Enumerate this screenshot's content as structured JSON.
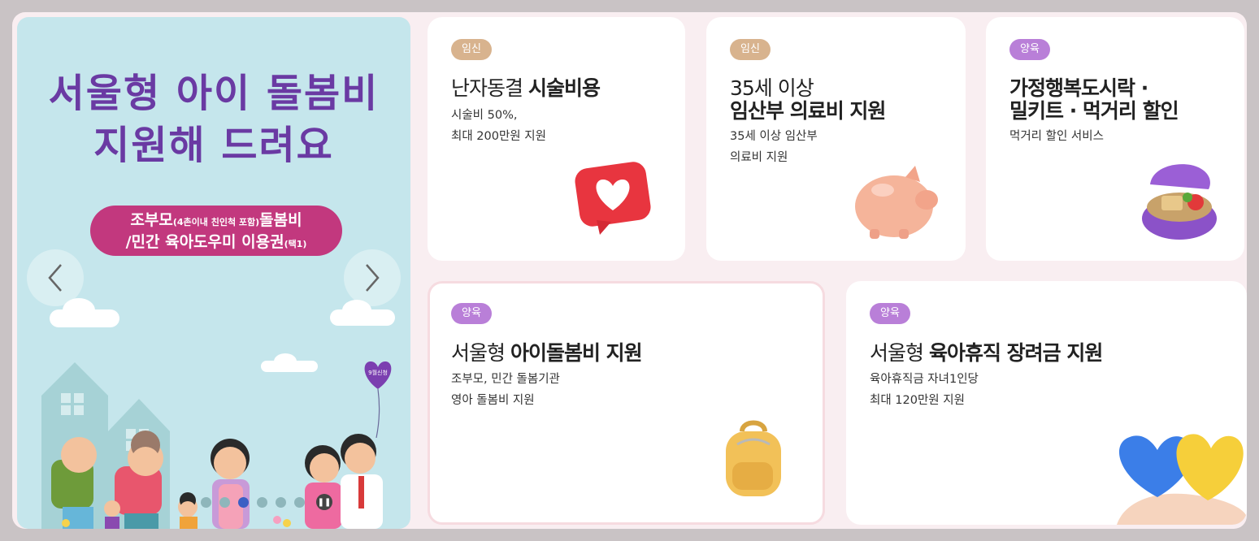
{
  "banner": {
    "title_line1": "서울형 아이 돌봄비",
    "title_line2": "지원해 드려요",
    "pill_part1": "조부모",
    "pill_small1": "(4촌이내 친인척 포함)",
    "pill_part2": "돌봄비",
    "pill_part3": "/민간 육아도우미 이용권",
    "pill_small2": "(택1)",
    "balloon_text": "9월신청",
    "active_slide": 3,
    "slide_count": 6
  },
  "cards": [
    {
      "tag": "임신",
      "title_light": "난자동결 ",
      "title_bold": "시술비용",
      "desc1": "시술비 50%,",
      "desc2": "최대 200만원 지원",
      "icon": "heart-notification-icon"
    },
    {
      "tag": "임신",
      "title_light": "35세 이상",
      "title_bold": "임산부 의료비 지원",
      "desc1": "35세 이상 임산부",
      "desc2": "의료비 지원",
      "icon": "piggy-bank-icon"
    },
    {
      "tag": "양육",
      "title_line1": "가정행복도시락 ·",
      "title_line2": "밀키트 · 먹거리 할인",
      "desc1": "먹거리 할인 서비스",
      "icon": "lunchbox-icon"
    },
    {
      "tag": "양육",
      "title_light": "서울형 ",
      "title_bold": "아이돌봄비 지원",
      "desc1": "조부모, 민간 돌봄기관",
      "desc2": "영아 돌봄비 지원",
      "icon": "backpack-icon"
    },
    {
      "tag": "양육",
      "title_light": "서울형 ",
      "title_bold": "육아휴직 장려금 지원",
      "desc1": "육아휴직금 자녀1인당",
      "desc2": "최대 120만원 지원",
      "icon": "hearts-in-hand-icon"
    }
  ],
  "colors": {
    "tag_pregnancy": "#d8b38e",
    "tag_childcare": "#b97fd8",
    "banner_bg": "#c5e6ec",
    "title_purple": "#6a3aa3",
    "pill_pink": "#c2387e"
  }
}
